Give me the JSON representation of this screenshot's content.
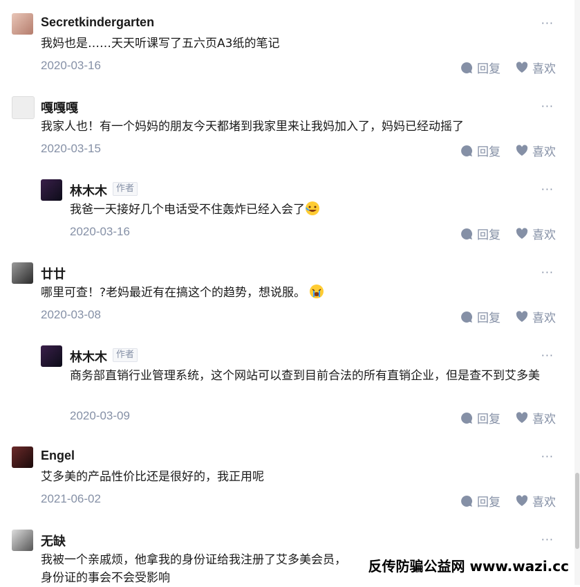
{
  "comments": [
    {
      "user": "Secretkindergarten",
      "text": "我妈也是……天天听课写了五六页A3纸的笔记",
      "date": "2020-03-16",
      "reply": "回复",
      "like": "喜欢",
      "more": "···"
    },
    {
      "user": "嘎嘎嘎",
      "text": "我家人也！有一个妈妈的朋友今天都堵到我家里来让我妈加入了，妈妈已经动摇了",
      "date": "2020-03-15",
      "reply": "回复",
      "like": "喜欢",
      "more": "···"
    },
    {
      "user": "林木木",
      "badge": "作者",
      "text": "我爸一天接好几个电话受不住轰炸已经入会了",
      "date": "2020-03-16",
      "reply": "回复",
      "like": "喜欢",
      "more": "···"
    },
    {
      "user": "廿廿",
      "text": "哪里可查！?老妈最近有在搞这个的趋势，想说服。",
      "date": "2020-03-08",
      "reply": "回复",
      "like": "喜欢",
      "more": "···"
    },
    {
      "user": "林木木",
      "badge": "作者",
      "text": "商务部直销行业管理系统，这个网站可以查到目前合法的所有直销企业，但是查不到艾多美",
      "date": "2020-03-09",
      "reply": "回复",
      "like": "喜欢",
      "more": "···"
    },
    {
      "user": "Engel",
      "text": "艾多美的产品性价比还是很好的，我正用呢",
      "date": "2021-06-02",
      "reply": "回复",
      "like": "喜欢",
      "more": "···"
    },
    {
      "user": "无缺",
      "text": "我被一个亲戚烦，他拿我的身份证给我注册了艾多美会员，",
      "text2": "身份证的事会不会受影响",
      "more": "···"
    }
  ],
  "watermark": "反传防骗公益网 www.wazi.cc",
  "colors": {
    "meta": "#8590a6",
    "text": "#1a1a1a"
  }
}
